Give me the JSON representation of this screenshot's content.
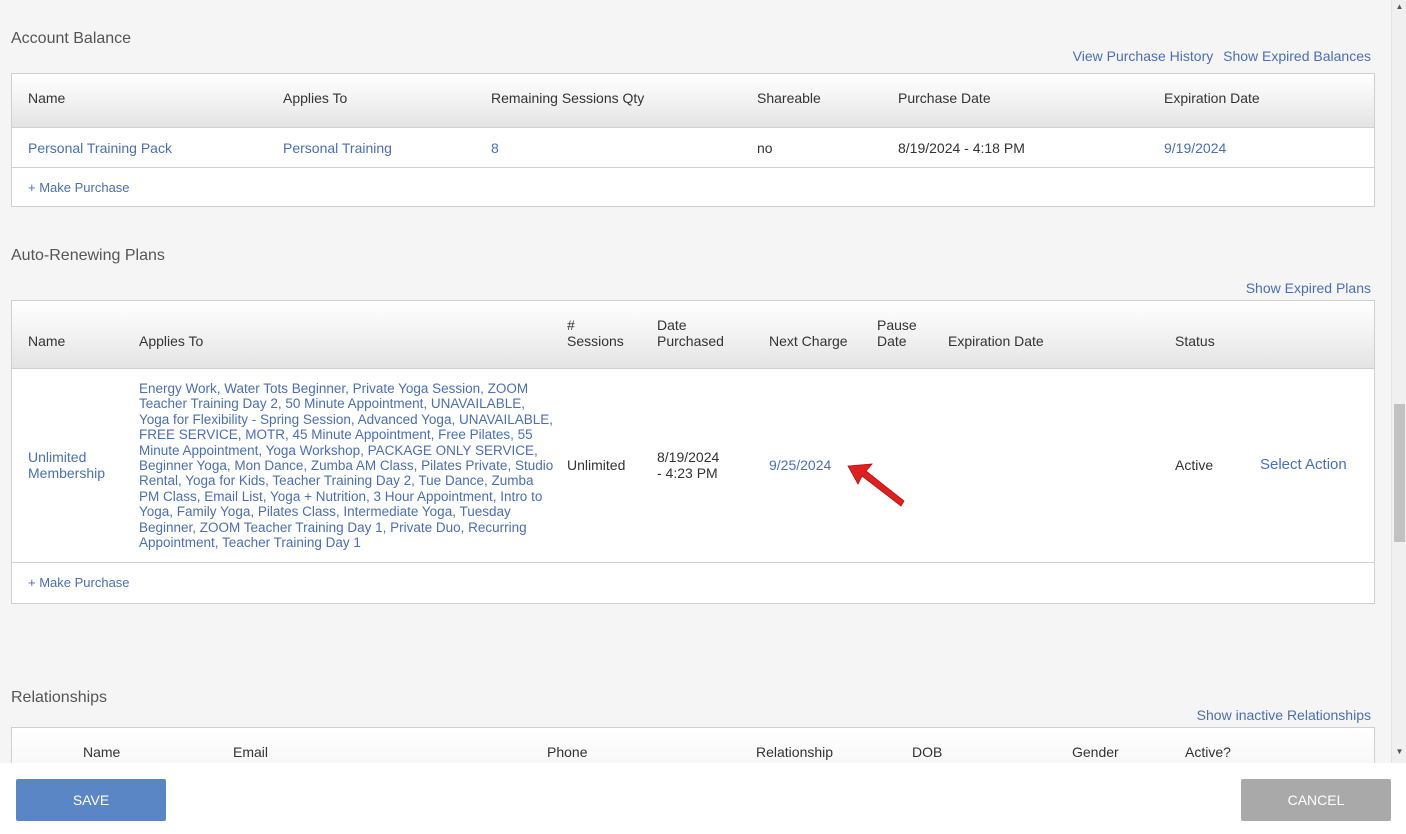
{
  "account_balance": {
    "title": "Account Balance",
    "links": {
      "history": "View Purchase History",
      "expired": "Show Expired Balances"
    },
    "headers": {
      "name": "Name",
      "applies": "Applies To",
      "remaining": "Remaining Sessions Qty",
      "shareable": "Shareable",
      "purchase_date": "Purchase Date",
      "expiration": "Expiration Date"
    },
    "row": {
      "name": "Personal Training Pack",
      "applies": "Personal Training",
      "remaining": "8",
      "shareable": "no",
      "purchase_date": "8/19/2024 - 4:18 PM",
      "expiration": "9/19/2024"
    },
    "make_purchase": "+ Make Purchase"
  },
  "auto_renewing": {
    "title": "Auto-Renewing Plans",
    "link_expired": "Show Expired Plans",
    "headers": {
      "name": "Name",
      "applies": "Applies To",
      "sessions_1": "#",
      "sessions_2": "Sessions",
      "date_purchased_1": "Date",
      "date_purchased_2": "Purchased",
      "next_charge": "Next Charge",
      "pause_1": "Pause",
      "pause_2": "Date",
      "expiration": "Expiration Date",
      "status": "Status"
    },
    "row": {
      "name_1": "Unlimited",
      "name_2": "Membership",
      "applies_lines": [
        "Energy Work, Water Tots Beginner, Private Yoga Session, ZOOM",
        "Teacher Training Day 2, 50 Minute Appointment, UNAVAILABLE,",
        "Yoga for Flexibility - Spring Session, Advanced Yoga, UNAVAILABLE,",
        "FREE SERVICE, MOTR, 45 Minute Appointment, Free Pilates, 55",
        "Minute Appointment, Yoga Workshop, PACKAGE ONLY SERVICE,",
        "Beginner Yoga, Mon Dance, Zumba AM Class, Pilates Private, Studio",
        "Rental, Yoga for Kids, Teacher Training Day 2, Tue Dance, Zumba",
        "PM Class, Email List, Yoga + Nutrition, 3 Hour Appointment, Intro to",
        "Yoga, Family Yoga, Pilates Class, Intermediate Yoga, Tuesday",
        "Beginner, ZOOM Teacher Training Day 1, Private Duo, Recurring",
        "Appointment, Teacher Training Day 1"
      ],
      "sessions": "Unlimited",
      "date_purchased_1": "8/19/2024",
      "date_purchased_2": "- 4:23 PM",
      "next_charge": "9/25/2024",
      "status": "Active",
      "action": "Select Action"
    },
    "make_purchase": "+ Make Purchase"
  },
  "relationships": {
    "title": "Relationships",
    "link_inactive": "Show inactive Relationships",
    "headers": {
      "name": "Name",
      "email": "Email",
      "phone": "Phone",
      "relationship": "Relationship",
      "dob": "DOB",
      "gender": "Gender",
      "active": "Active?"
    }
  },
  "buttons": {
    "save": "SAVE",
    "cancel": "CANCEL"
  },
  "colors": {
    "link": "#4a6fb3",
    "save": "#5b86c5",
    "cancel": "#a9a9a9",
    "arrow": "#e02020"
  }
}
